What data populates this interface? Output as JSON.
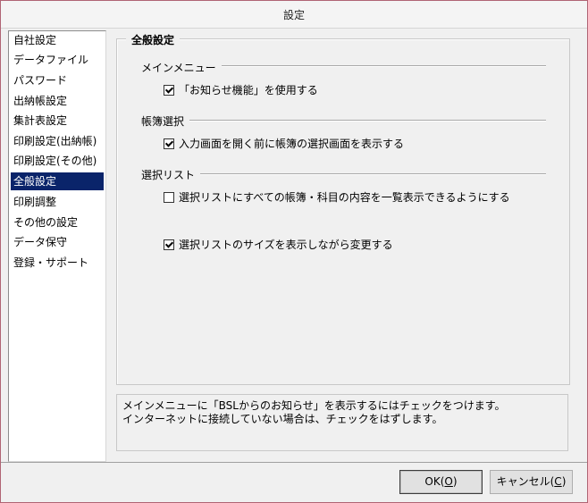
{
  "window": {
    "title": "設定"
  },
  "sidebar": {
    "items": [
      {
        "label": "自社設定"
      },
      {
        "label": "データファイル"
      },
      {
        "label": "パスワード"
      },
      {
        "label": "出納帳設定"
      },
      {
        "label": "集計表設定"
      },
      {
        "label": "印刷設定(出納帳)"
      },
      {
        "label": "印刷設定(その他)"
      },
      {
        "label": "全般設定",
        "selected": true
      },
      {
        "label": "印刷調整"
      },
      {
        "label": "その他の設定"
      },
      {
        "label": "データ保守"
      },
      {
        "label": "登録・サポート"
      }
    ]
  },
  "panel": {
    "title": "全般設定",
    "sections": [
      {
        "label": "メインメニュー",
        "options": [
          {
            "label": "「お知らせ機能」を使用する",
            "checked": true
          }
        ]
      },
      {
        "label": "帳簿選択",
        "options": [
          {
            "label": "入力画面を開く前に帳簿の選択画面を表示する",
            "checked": true
          }
        ]
      },
      {
        "label": "選択リスト",
        "options": [
          {
            "label": "選択リストにすべての帳簿・科目の内容を一覧表示できるようにする",
            "checked": false
          },
          {
            "label": "選択リストのサイズを表示しながら変更する",
            "checked": true
          }
        ]
      }
    ]
  },
  "description": {
    "line1": "メインメニューに「BSLからのお知らせ」を表示するにはチェックをつけます。",
    "line2": "インターネットに接続していない場合は、チェックをはずします。"
  },
  "buttons": {
    "ok": {
      "label": "OK(",
      "accel": "O",
      "suffix": ")"
    },
    "cancel": {
      "label": "キャンセル(",
      "accel": "C",
      "suffix": ")"
    }
  },
  "colors": {
    "selection": "#0a246a",
    "window_border": "#b06474"
  }
}
